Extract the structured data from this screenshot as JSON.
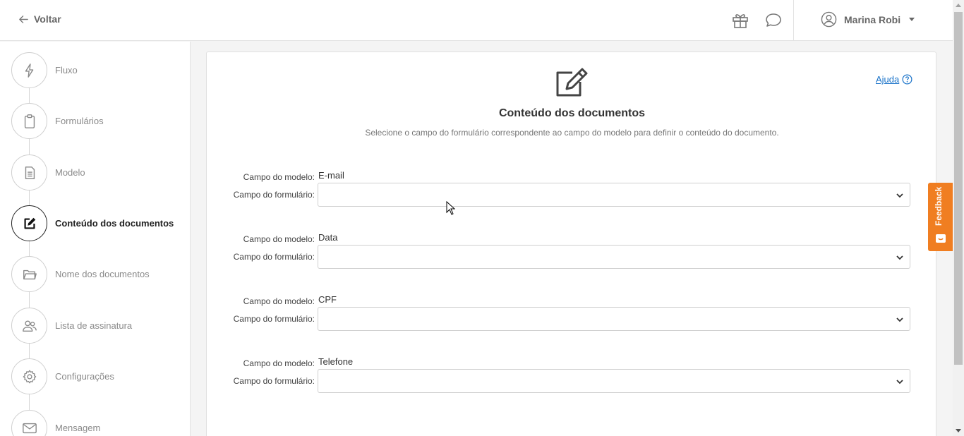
{
  "header": {
    "back_label": "Voltar",
    "gift_icon": "gift-icon",
    "chat_icon": "chat-bubble-icon",
    "user_name": "Marina Robi"
  },
  "sidebar": {
    "steps": [
      {
        "label": "Fluxo",
        "icon": "lightning-icon",
        "active": false
      },
      {
        "label": "Formulários",
        "icon": "clipboard-icon",
        "active": false
      },
      {
        "label": "Modelo",
        "icon": "document-icon",
        "active": false
      },
      {
        "label": "Conteúdo dos documentos",
        "icon": "edit-icon",
        "active": true
      },
      {
        "label": "Nome dos documentos",
        "icon": "folder-icon",
        "active": false
      },
      {
        "label": "Lista de assinatura",
        "icon": "users-icon",
        "active": false
      },
      {
        "label": "Configurações",
        "icon": "gear-icon",
        "active": false
      },
      {
        "label": "Mensagem",
        "icon": "envelope-icon",
        "active": false
      }
    ]
  },
  "main": {
    "help_label": "Ajuda",
    "title": "Conteúdo dos documentos",
    "subtitle": "Selecione o campo do formulário correspondente ao campo do modelo para definir o conteúdo do documento.",
    "model_field_label": "Campo do modelo:",
    "form_field_label": "Campo do formulário:",
    "fields": [
      {
        "model": "E-mail",
        "form_value": ""
      },
      {
        "model": "Data",
        "form_value": ""
      },
      {
        "model": "CPF",
        "form_value": ""
      },
      {
        "model": "Telefone",
        "form_value": ""
      }
    ]
  },
  "feedback": {
    "label": "Feedback"
  },
  "colors": {
    "accent": "#f07e21",
    "link": "#1a73c9"
  }
}
